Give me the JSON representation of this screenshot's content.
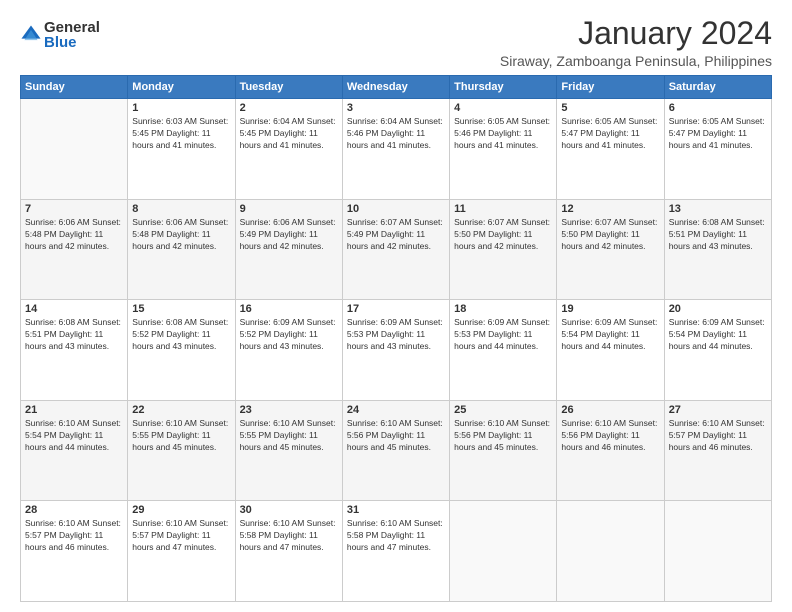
{
  "logo": {
    "general": "General",
    "blue": "Blue"
  },
  "title": {
    "month_year": "January 2024",
    "location": "Siraway, Zamboanga Peninsula, Philippines"
  },
  "headers": [
    "Sunday",
    "Monday",
    "Tuesday",
    "Wednesday",
    "Thursday",
    "Friday",
    "Saturday"
  ],
  "weeks": [
    [
      {
        "day": "",
        "detail": ""
      },
      {
        "day": "1",
        "detail": "Sunrise: 6:03 AM\nSunset: 5:45 PM\nDaylight: 11 hours\nand 41 minutes."
      },
      {
        "day": "2",
        "detail": "Sunrise: 6:04 AM\nSunset: 5:45 PM\nDaylight: 11 hours\nand 41 minutes."
      },
      {
        "day": "3",
        "detail": "Sunrise: 6:04 AM\nSunset: 5:46 PM\nDaylight: 11 hours\nand 41 minutes."
      },
      {
        "day": "4",
        "detail": "Sunrise: 6:05 AM\nSunset: 5:46 PM\nDaylight: 11 hours\nand 41 minutes."
      },
      {
        "day": "5",
        "detail": "Sunrise: 6:05 AM\nSunset: 5:47 PM\nDaylight: 11 hours\nand 41 minutes."
      },
      {
        "day": "6",
        "detail": "Sunrise: 6:05 AM\nSunset: 5:47 PM\nDaylight: 11 hours\nand 41 minutes."
      }
    ],
    [
      {
        "day": "7",
        "detail": "Sunrise: 6:06 AM\nSunset: 5:48 PM\nDaylight: 11 hours\nand 42 minutes."
      },
      {
        "day": "8",
        "detail": "Sunrise: 6:06 AM\nSunset: 5:48 PM\nDaylight: 11 hours\nand 42 minutes."
      },
      {
        "day": "9",
        "detail": "Sunrise: 6:06 AM\nSunset: 5:49 PM\nDaylight: 11 hours\nand 42 minutes."
      },
      {
        "day": "10",
        "detail": "Sunrise: 6:07 AM\nSunset: 5:49 PM\nDaylight: 11 hours\nand 42 minutes."
      },
      {
        "day": "11",
        "detail": "Sunrise: 6:07 AM\nSunset: 5:50 PM\nDaylight: 11 hours\nand 42 minutes."
      },
      {
        "day": "12",
        "detail": "Sunrise: 6:07 AM\nSunset: 5:50 PM\nDaylight: 11 hours\nand 42 minutes."
      },
      {
        "day": "13",
        "detail": "Sunrise: 6:08 AM\nSunset: 5:51 PM\nDaylight: 11 hours\nand 43 minutes."
      }
    ],
    [
      {
        "day": "14",
        "detail": "Sunrise: 6:08 AM\nSunset: 5:51 PM\nDaylight: 11 hours\nand 43 minutes."
      },
      {
        "day": "15",
        "detail": "Sunrise: 6:08 AM\nSunset: 5:52 PM\nDaylight: 11 hours\nand 43 minutes."
      },
      {
        "day": "16",
        "detail": "Sunrise: 6:09 AM\nSunset: 5:52 PM\nDaylight: 11 hours\nand 43 minutes."
      },
      {
        "day": "17",
        "detail": "Sunrise: 6:09 AM\nSunset: 5:53 PM\nDaylight: 11 hours\nand 43 minutes."
      },
      {
        "day": "18",
        "detail": "Sunrise: 6:09 AM\nSunset: 5:53 PM\nDaylight: 11 hours\nand 44 minutes."
      },
      {
        "day": "19",
        "detail": "Sunrise: 6:09 AM\nSunset: 5:54 PM\nDaylight: 11 hours\nand 44 minutes."
      },
      {
        "day": "20",
        "detail": "Sunrise: 6:09 AM\nSunset: 5:54 PM\nDaylight: 11 hours\nand 44 minutes."
      }
    ],
    [
      {
        "day": "21",
        "detail": "Sunrise: 6:10 AM\nSunset: 5:54 PM\nDaylight: 11 hours\nand 44 minutes."
      },
      {
        "day": "22",
        "detail": "Sunrise: 6:10 AM\nSunset: 5:55 PM\nDaylight: 11 hours\nand 45 minutes."
      },
      {
        "day": "23",
        "detail": "Sunrise: 6:10 AM\nSunset: 5:55 PM\nDaylight: 11 hours\nand 45 minutes."
      },
      {
        "day": "24",
        "detail": "Sunrise: 6:10 AM\nSunset: 5:56 PM\nDaylight: 11 hours\nand 45 minutes."
      },
      {
        "day": "25",
        "detail": "Sunrise: 6:10 AM\nSunset: 5:56 PM\nDaylight: 11 hours\nand 45 minutes."
      },
      {
        "day": "26",
        "detail": "Sunrise: 6:10 AM\nSunset: 5:56 PM\nDaylight: 11 hours\nand 46 minutes."
      },
      {
        "day": "27",
        "detail": "Sunrise: 6:10 AM\nSunset: 5:57 PM\nDaylight: 11 hours\nand 46 minutes."
      }
    ],
    [
      {
        "day": "28",
        "detail": "Sunrise: 6:10 AM\nSunset: 5:57 PM\nDaylight: 11 hours\nand 46 minutes."
      },
      {
        "day": "29",
        "detail": "Sunrise: 6:10 AM\nSunset: 5:57 PM\nDaylight: 11 hours\nand 47 minutes."
      },
      {
        "day": "30",
        "detail": "Sunrise: 6:10 AM\nSunset: 5:58 PM\nDaylight: 11 hours\nand 47 minutes."
      },
      {
        "day": "31",
        "detail": "Sunrise: 6:10 AM\nSunset: 5:58 PM\nDaylight: 11 hours\nand 47 minutes."
      },
      {
        "day": "",
        "detail": ""
      },
      {
        "day": "",
        "detail": ""
      },
      {
        "day": "",
        "detail": ""
      }
    ]
  ]
}
